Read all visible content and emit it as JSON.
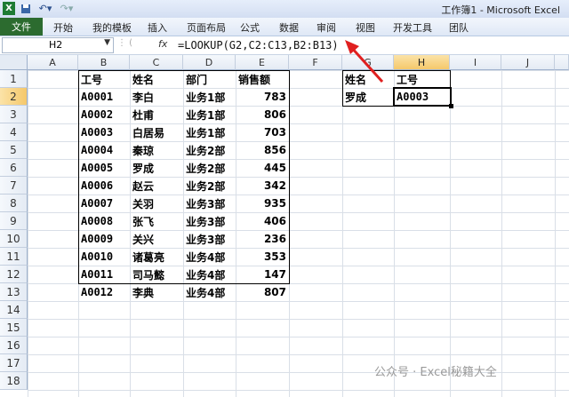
{
  "window": {
    "title": "工作簿1 - Microsoft Excel"
  },
  "quick_access": {
    "icons": [
      "excel-icon",
      "save-icon",
      "undo-icon",
      "redo-icon"
    ]
  },
  "ribbon": {
    "file_tab": "文件",
    "tabs": [
      "开始",
      "我的模板",
      "插入",
      "页面布局",
      "公式",
      "数据",
      "审阅",
      "视图",
      "开发工具",
      "团队"
    ]
  },
  "formula_bar": {
    "name_box": "H2",
    "fx": "fx",
    "formula": "=LOOKUP(G2,C2:C13,B2:B13)"
  },
  "columns": [
    "A",
    "B",
    "C",
    "D",
    "E",
    "F",
    "G",
    "H",
    "I",
    "J"
  ],
  "selected_column": "H",
  "rows": [
    "1",
    "2",
    "3",
    "4",
    "5",
    "6",
    "7",
    "8",
    "9",
    "10",
    "11",
    "12",
    "13",
    "14",
    "15",
    "16",
    "17",
    "18"
  ],
  "selected_row": "2",
  "table": {
    "headers": [
      "工号",
      "姓名",
      "部门",
      "销售额"
    ],
    "rows": [
      [
        "A0001",
        "李白",
        "业务1部",
        "783"
      ],
      [
        "A0002",
        "杜甫",
        "业务1部",
        "806"
      ],
      [
        "A0003",
        "白居易",
        "业务1部",
        "703"
      ],
      [
        "A0004",
        "秦琼",
        "业务2部",
        "856"
      ],
      [
        "A0005",
        "罗成",
        "业务2部",
        "445"
      ],
      [
        "A0006",
        "赵云",
        "业务2部",
        "342"
      ],
      [
        "A0007",
        "关羽",
        "业务3部",
        "935"
      ],
      [
        "A0008",
        "张飞",
        "业务3部",
        "406"
      ],
      [
        "A0009",
        "关兴",
        "业务3部",
        "236"
      ],
      [
        "A0010",
        "诸葛亮",
        "业务4部",
        "353"
      ],
      [
        "A0011",
        "司马懿",
        "业务4部",
        "147"
      ],
      [
        "A0012",
        "李典",
        "业务4部",
        "807"
      ]
    ]
  },
  "lookup": {
    "header_name": "姓名",
    "header_id": "工号",
    "name_value": "罗成",
    "result_value": "A0003"
  },
  "watermark": "公众号 · Excel秘籍大全",
  "colors": {
    "file_tab": "#2c6b2f",
    "arrow": "#e02020",
    "selected_header": "#f5c86a"
  }
}
